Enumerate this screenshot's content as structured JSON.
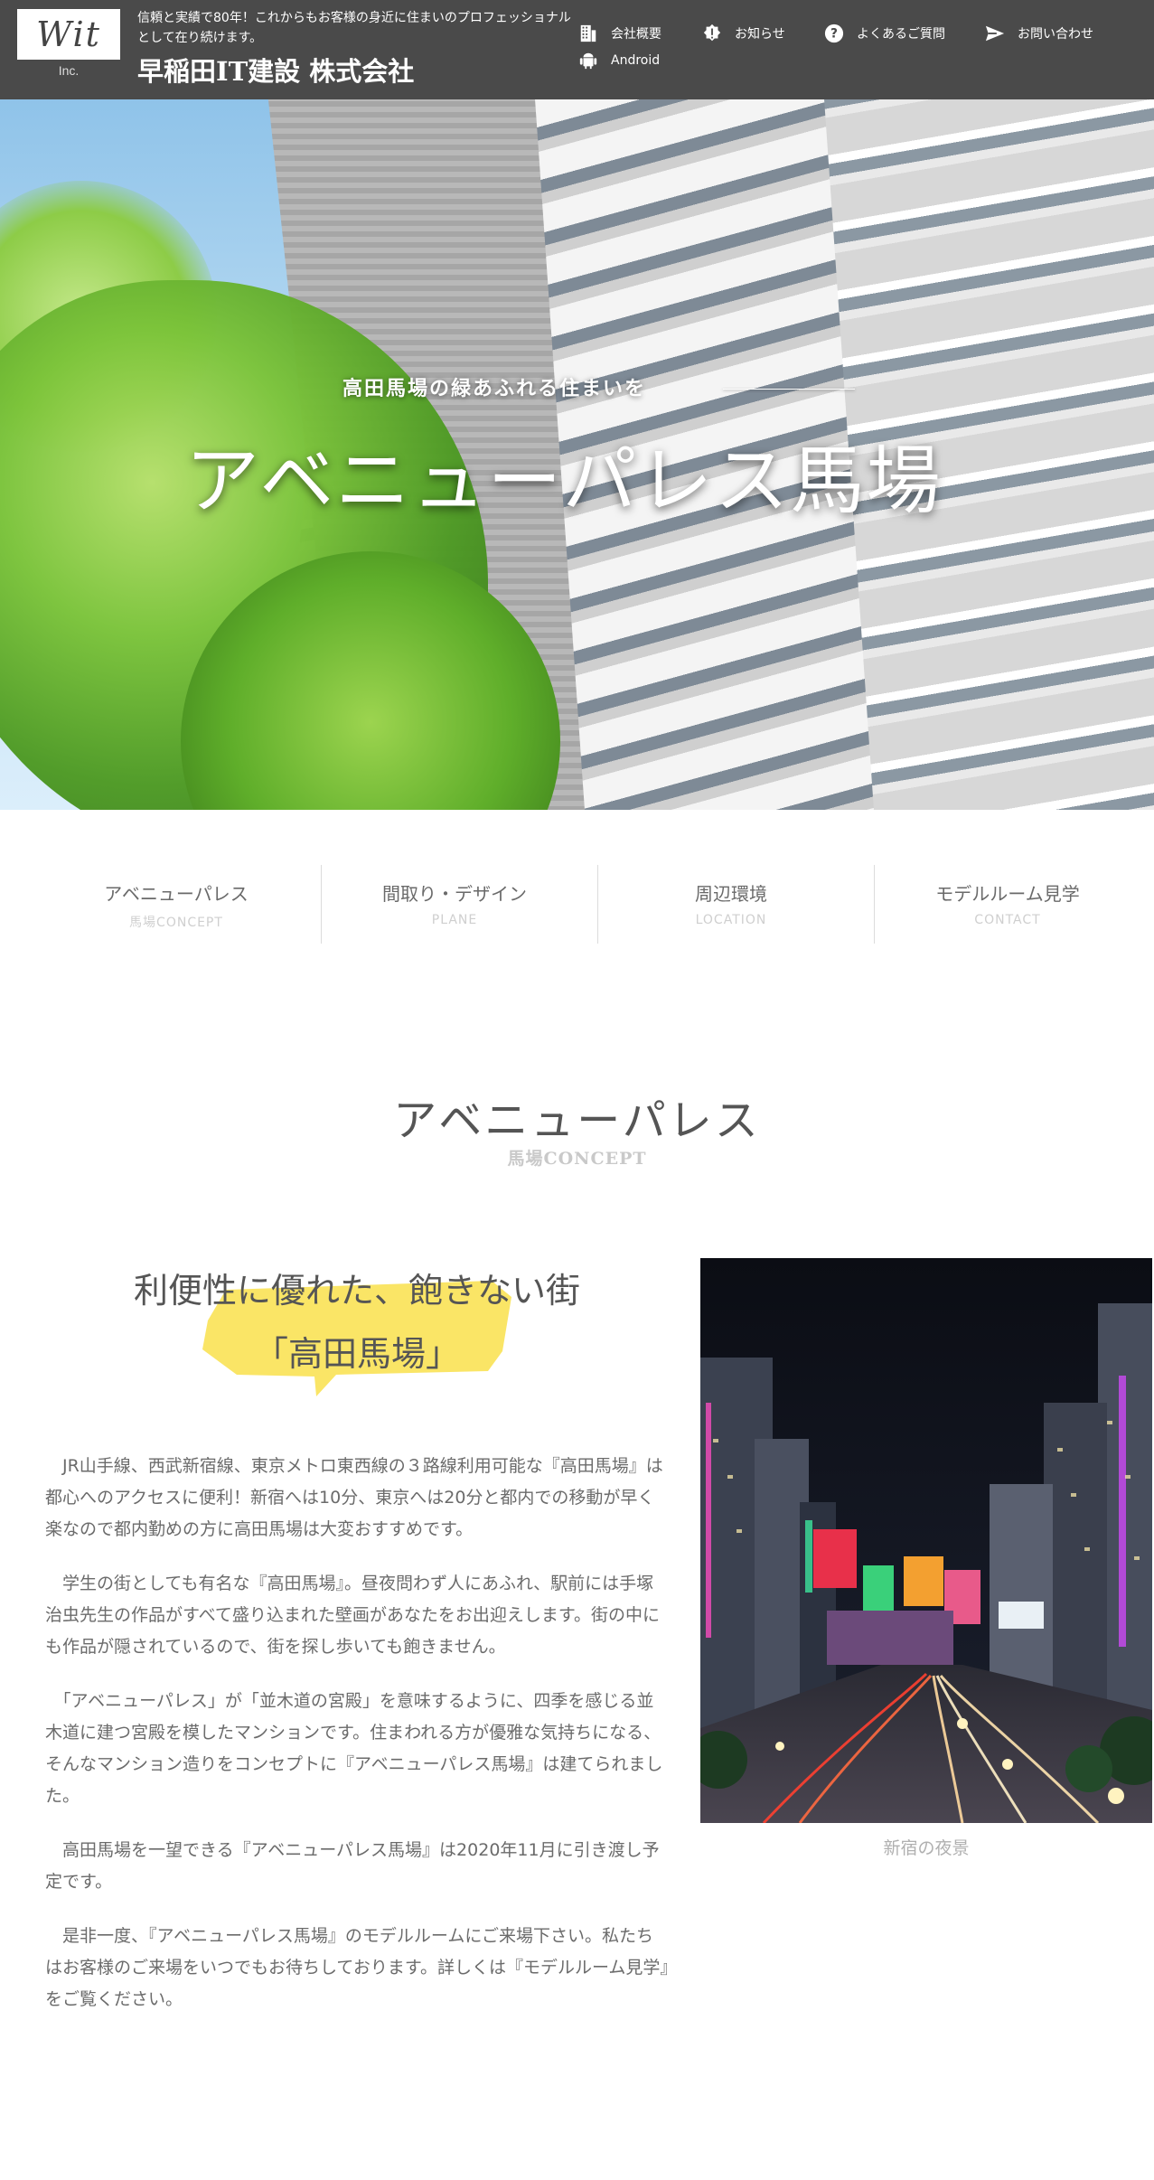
{
  "header": {
    "logo_text": "Wit",
    "logo_sub": "Inc.",
    "tagline": "信頼と実績で80年！これからもお客様の身近に住まいのプロフェッショナルとして在り続けます。",
    "company": "早稲田IT建設 株式会社",
    "nav": [
      {
        "label": "会社概要",
        "icon": "building-icon"
      },
      {
        "label": "お知らせ",
        "icon": "info-badge-icon"
      },
      {
        "label": "よくあるご質問",
        "icon": "question-circle-icon"
      },
      {
        "label": "お問い合わせ",
        "icon": "paper-plane-icon"
      },
      {
        "label": "Android",
        "icon": "android-icon"
      }
    ]
  },
  "hero": {
    "subtitle": "高田馬場の緑あふれる住まいを",
    "title": "アベニューパレス馬場"
  },
  "tabs": [
    {
      "label": "アベニューパレス",
      "sub": "馬場CONCEPT"
    },
    {
      "label": "間取り・デザイン",
      "sub": "PLANE"
    },
    {
      "label": "周辺環境",
      "sub": "LOCATION"
    },
    {
      "label": "モデルルーム見学",
      "sub": "CONTACT"
    }
  ],
  "concept": {
    "title": "アベニューパレス",
    "sub": "馬場CONCEPT",
    "headline_line1": "利便性に優れた、飽きない街",
    "headline_line2": "「高田馬場」",
    "paragraphs": [
      "　JR山手線、西武新宿線、東京メトロ東西線の３路線利用可能な『高田馬場』は都心へのアクセスに便利！新宿へは10分、東京へは20分と都内での移動が早く楽なので都内勤めの方に高田馬場は大変おすすめです。",
      "　学生の街としても有名な『高田馬場』。昼夜問わず人にあふれ、駅前には手塚治虫先生の作品がすべて盛り込まれた壁画があなたをお出迎えします。街の中にも作品が隠されているので、街を探し歩いても飽きません。",
      "　「アベニューパレス」が「並木道の宮殿」を意味するように、四季を感じる並木道に建つ宮殿を模したマンションです。住まわれる方が優雅な気持ちになる、そんなマンション造りをコンセプトに『アベニューパレス馬場』は建てられました。",
      "　高田馬場を一望できる『アベニューパレス馬場』は2020年11月に引き渡し予定です。",
      "　是非一度、『アベニューパレス馬場』のモデルルームにご来場下さい。私たちはお客様のご来場をいつでもお待ちしております。詳しくは『モデルルーム見学』をご覧ください。"
    ],
    "photo_caption": "新宿の夜景"
  },
  "colors": {
    "header_bg": "#4a4a4a",
    "highlight": "#f9e04b",
    "text": "#6b6b6b",
    "sub_text": "#cfcfcf"
  }
}
